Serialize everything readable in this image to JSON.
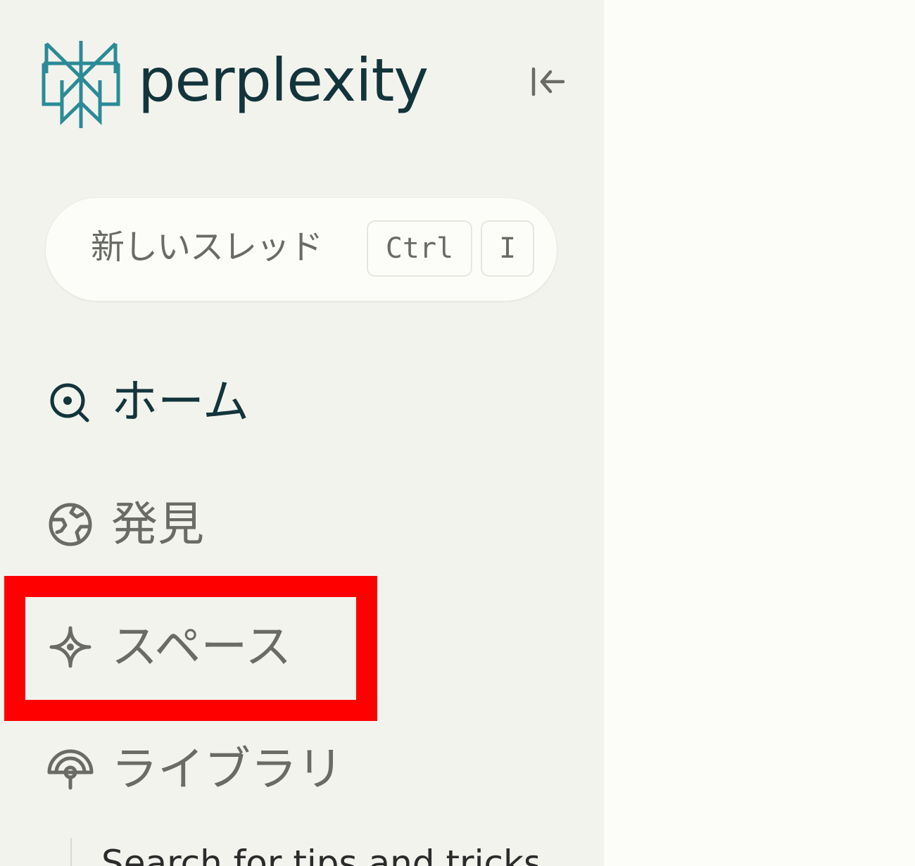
{
  "brand": {
    "name": "perplexity",
    "color": "#13343b",
    "accent": "#2b8b96"
  },
  "sidebar": {
    "collapse_icon": "collapse-sidebar-icon",
    "new_thread": {
      "label": "新しいスレッド",
      "shortcut": [
        "Ctrl",
        "I"
      ]
    },
    "nav": [
      {
        "label": "ホーム",
        "icon": "home-search-icon",
        "active": true
      },
      {
        "label": "発見",
        "icon": "globe-icon",
        "active": false
      },
      {
        "label": "スペース",
        "icon": "sparkle-icon",
        "active": false
      },
      {
        "label": "ライブラリ",
        "icon": "library-icon",
        "active": false
      }
    ],
    "library_preview": "Search for tips and tricks"
  },
  "annotation": {
    "highlight_color": "#ff0000",
    "target": "スペース"
  }
}
